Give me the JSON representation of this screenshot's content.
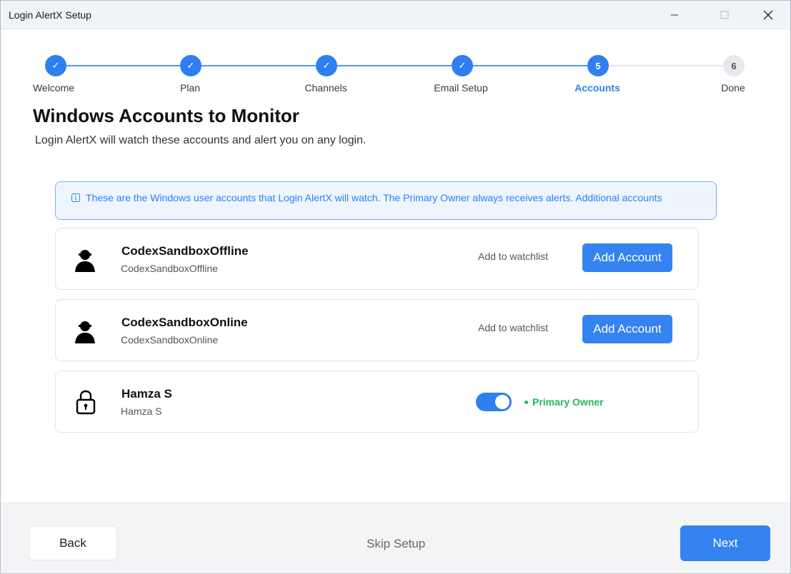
{
  "window": {
    "title": "Login AlertX Setup"
  },
  "stepper": {
    "steps": [
      {
        "label": "Welcome",
        "marker": "✓",
        "state": "done"
      },
      {
        "label": "Plan",
        "marker": "✓",
        "state": "done"
      },
      {
        "label": "Channels",
        "marker": "✓",
        "state": "done"
      },
      {
        "label": "Email Setup",
        "marker": "✓",
        "state": "done"
      },
      {
        "label": "Accounts",
        "marker": "5",
        "state": "active"
      },
      {
        "label": "Done",
        "marker": "6",
        "state": "todo"
      }
    ]
  },
  "main": {
    "title": "Windows Accounts to Monitor",
    "subtitle": "Login AlertX will watch these accounts and alert you on any login.",
    "info": "These are the Windows user accounts that Login AlertX will watch. The Primary Owner always receives alerts. Additional accounts"
  },
  "accounts": [
    {
      "name": "CodexSandboxOffline",
      "sub": "CodexSandboxOffline",
      "icon": "user-icon",
      "watch_label": "Add to watchlist",
      "button_label": "Add Account"
    },
    {
      "name": "CodexSandboxOnline",
      "sub": "CodexSandboxOnline",
      "icon": "user-icon",
      "watch_label": "Add to watchlist",
      "button_label": "Add Account"
    },
    {
      "name": "Hamza S",
      "sub": "Hamza S",
      "icon": "lock-icon",
      "toggle_on": true,
      "badge": "Primary Owner"
    }
  ],
  "footer": {
    "back_label": "Back",
    "skip_label": "Skip Setup",
    "next_label": "Next"
  },
  "colors": {
    "accent": "#2f7ff0",
    "success": "#22b95a",
    "muted_step": "#e7e9ee"
  }
}
